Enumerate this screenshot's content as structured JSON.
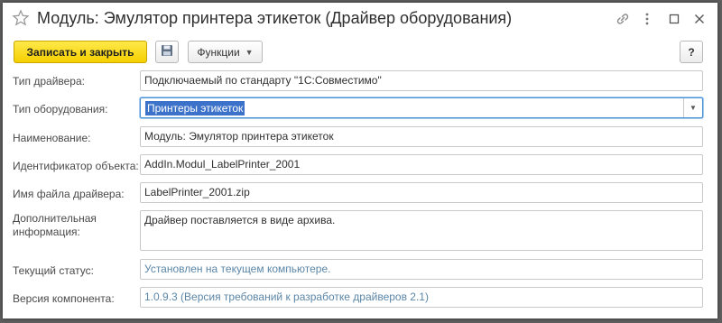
{
  "window": {
    "title": "Модуль: Эмулятор принтера этикеток (Драйвер оборудования)",
    "icons": [
      "star-icon",
      "link-icon",
      "more-icon",
      "maximize-icon",
      "close-icon"
    ]
  },
  "toolbar": {
    "save_close_label": "Записать и закрыть",
    "functions_label": "Функции",
    "help_label": "?"
  },
  "form": {
    "driver_type": {
      "label": "Тип драйвера:",
      "value": "Подключаемый по стандарту \"1С:Совместимо\""
    },
    "equipment_type": {
      "label": "Тип оборудования:",
      "value": "Принтеры этикеток"
    },
    "name": {
      "label": "Наименование:",
      "value": "Модуль: Эмулятор принтера этикеток"
    },
    "object_id": {
      "label": "Идентификатор объекта:",
      "value": "AddIn.Modul_LabelPrinter_2001"
    },
    "driver_file": {
      "label": "Имя файла драйвера:",
      "value": "LabelPrinter_2001.zip"
    },
    "extra_info": {
      "label_line1": "Дополнительная",
      "label_line2": "информация:",
      "value": "Драйвер поставляется в виде архива."
    },
    "status": {
      "label": "Текущий статус:",
      "value": "Установлен на текущем компьютере."
    },
    "version": {
      "label": "Версия компонента:",
      "value": "1.0.9.3 (Версия требований к разработке драйверов 2.1)"
    }
  },
  "colors": {
    "primary_button": "#f5cf00",
    "selection": "#3c72c9",
    "status_text": "#5b86a7",
    "focus_border": "#4a91d6"
  }
}
